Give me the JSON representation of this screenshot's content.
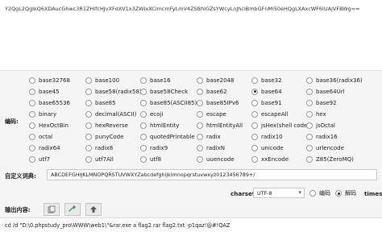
{
  "input_text": "Y2QgL2QglkQ6XDAucGhwc3R1ZHlfcHJvXFdXV1x3ZWIxXClmcmFyLmV4ZSBhIGZsYWcyLnJhciBmbGFnMi50eHQgLXAxcWF6IUAjVFBWg==",
  "encoding_label": "编码:",
  "options": [
    [
      "base32768",
      "base100",
      "base16",
      "base2048",
      "base32",
      "base36(radix36)"
    ],
    [
      "base45",
      "base58(radix58)",
      "base58Check",
      "base62",
      "base64",
      "base64Url"
    ],
    [
      "base65536",
      "base85",
      "base85(ASCII85)",
      "base85IPv6",
      "base91",
      "base92"
    ],
    [
      "binary",
      "decimal(ASCII)",
      "ecoji",
      "escape",
      "escapeAll",
      "hex"
    ],
    [
      "HexOctBin",
      "hexReverse",
      "htmlEntity",
      "htmlEntityAll",
      "jsHex(shell code)",
      "jsOctal"
    ],
    [
      "octal",
      "punyCode",
      "quotedPrintable",
      "radix",
      "radix10",
      "radix16"
    ],
    [
      "radix64",
      "radix8",
      "radix9",
      "radixN",
      "unicode",
      "urlencode"
    ],
    [
      "utf7",
      "utf7All",
      "utf8",
      "uuencode",
      "xxEncode",
      "Z85(ZeroMQ)"
    ]
  ],
  "selected_option": "base64",
  "dict_label": "自定义词典:",
  "dict_value": "ABCDEFGHIJKLMNOPQRSTUVWXYZabcdefghijklmnopqrstuvwxyz0123456789+/",
  "charset_label": "charset:",
  "charset_value": "UTF-8",
  "mode_encode": "编码",
  "mode_decode": "解码",
  "mode_selected": "decode",
  "times_label": "times",
  "output_label": "输出内容:",
  "output_text": "cd /d \"D:\\0.phpstudy_pro\\WWW\\web1\\\"&rar.exe a flag2.rar flag2.txt -p1qaz!@#!QAZ"
}
